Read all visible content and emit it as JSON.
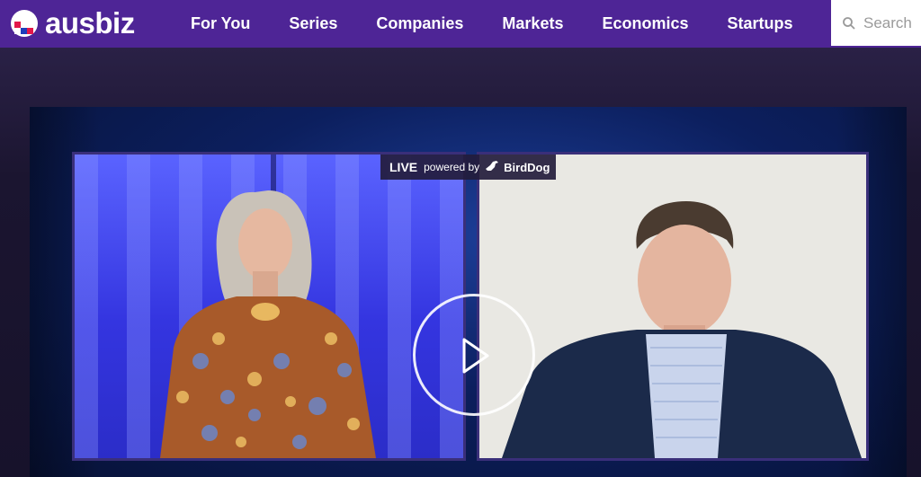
{
  "header": {
    "logo_text": "ausbiz",
    "logo_icon": "ausbiz-logo-mark",
    "nav": [
      {
        "label": "For You"
      },
      {
        "label": "Series"
      },
      {
        "label": "Companies"
      },
      {
        "label": "Markets"
      },
      {
        "label": "Economics"
      },
      {
        "label": "Startups"
      }
    ],
    "search": {
      "placeholder": "Search",
      "icon": "search-icon"
    }
  },
  "player": {
    "live_label": "LIVE",
    "powered_by": "powered by",
    "partner": "BirdDog",
    "play_icon": "play-icon"
  },
  "colors": {
    "header_bg": "#4e2596",
    "page_bg": "#1c1630",
    "player_bg": "#0c1f5e"
  }
}
